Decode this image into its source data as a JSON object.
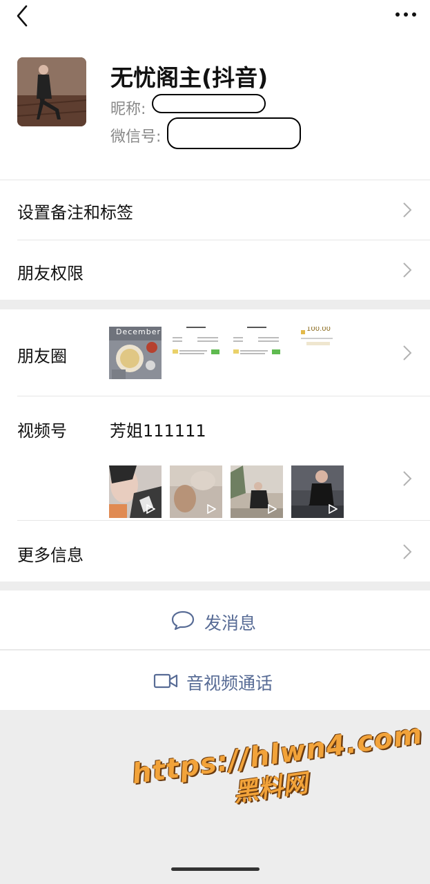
{
  "topbar": {
    "back_icon": "back-chevron-icon",
    "more_icon": "more-dots-icon"
  },
  "profile": {
    "name": "无忧阁主(抖音)",
    "nickname_label": "昵称:",
    "wechat_id_label": "微信号:"
  },
  "rows": {
    "remark": "设置备注和标签",
    "permission": "朋友权限",
    "moments": "朋友圈",
    "channels": "视频号",
    "channels_name": "芳姐111111",
    "more_info": "更多信息"
  },
  "moments_thumbs": {
    "december": "December",
    "price": "100.00"
  },
  "actions": {
    "message": "发消息",
    "call": "音视频通话"
  },
  "watermark": {
    "url": "https://hlwn4.com",
    "site": "黑料网"
  },
  "colors": {
    "link_blue": "#576b95",
    "background": "#ededed",
    "watermark": "#f2a33a"
  }
}
